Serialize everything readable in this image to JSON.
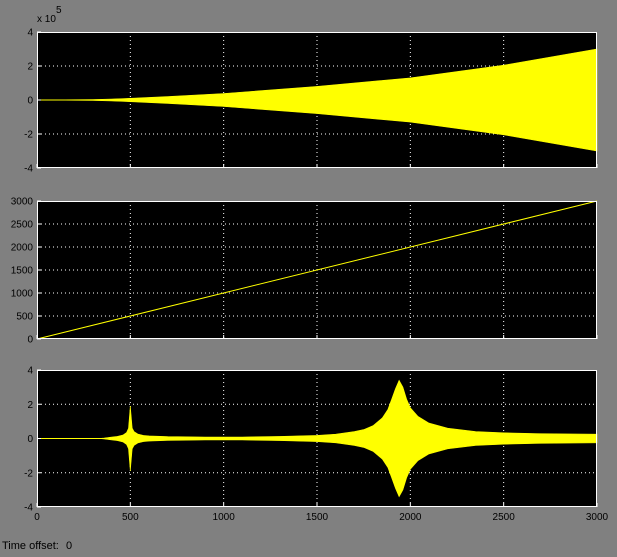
{
  "colors": {
    "figure_bg": "#808080",
    "axes_bg": "#000000",
    "trace": "#ffff00",
    "grid": "#ffffff",
    "text": "#000000"
  },
  "status": {
    "time_offset_label": "Time offset:",
    "time_offset_value": "0"
  },
  "chart_data": [
    {
      "type": "area",
      "description_style": "envelope",
      "xlim": [
        0,
        3000
      ],
      "ylim": [
        -4,
        4
      ],
      "y_multiplier_label": "x 10",
      "y_multiplier_exponent": "5",
      "xticks": [
        0,
        500,
        1000,
        1500,
        2000,
        2500,
        3000
      ],
      "yticks": [
        -4,
        -2,
        0,
        2,
        4
      ],
      "ytick_labels": [
        "-4",
        "-2",
        "0",
        "2",
        "4"
      ],
      "show_xtick_labels": false,
      "grid": true,
      "x": [
        0,
        300,
        400,
        500,
        700,
        1000,
        1500,
        2000,
        2500,
        3000
      ],
      "upper": [
        0.0,
        0.03,
        0.06,
        0.1,
        0.2,
        0.38,
        0.8,
        1.3,
        2.05,
        3.0
      ],
      "lower": [
        0.0,
        -0.03,
        -0.06,
        -0.1,
        -0.2,
        -0.38,
        -0.8,
        -1.3,
        -2.05,
        -3.0
      ]
    },
    {
      "type": "line",
      "xlim": [
        0,
        3000
      ],
      "ylim": [
        0,
        3000
      ],
      "xticks": [
        0,
        500,
        1000,
        1500,
        2000,
        2500,
        3000
      ],
      "yticks": [
        0,
        500,
        1000,
        1500,
        2000,
        2500,
        3000
      ],
      "ytick_labels": [
        "0",
        "500",
        "1000",
        "1500",
        "2000",
        "2500",
        "3000"
      ],
      "show_xtick_labels": false,
      "grid": true,
      "x": [
        0,
        3000
      ],
      "y": [
        0,
        3000
      ]
    },
    {
      "type": "area",
      "description_style": "envelope",
      "xlim": [
        0,
        3000
      ],
      "ylim": [
        -4,
        4
      ],
      "xticks": [
        0,
        500,
        1000,
        1500,
        2000,
        2500,
        3000
      ],
      "xtick_labels": [
        "0",
        "500",
        "1000",
        "1500",
        "2000",
        "2500",
        "3000"
      ],
      "yticks": [
        -4,
        -2,
        0,
        2,
        4
      ],
      "ytick_labels": [
        "-4",
        "-2",
        "0",
        "2",
        "4"
      ],
      "show_xtick_labels": true,
      "grid": true,
      "x": [
        0,
        330,
        360,
        400,
        430,
        460,
        480,
        490,
        500,
        510,
        520,
        540,
        570,
        600,
        700,
        900,
        1100,
        1300,
        1500,
        1600,
        1700,
        1750,
        1800,
        1850,
        1880,
        1900,
        1920,
        1940,
        1960,
        1980,
        2000,
        2040,
        2100,
        2200,
        2350,
        2500,
        2700,
        3000
      ],
      "upper": [
        0.0,
        0.0,
        0.03,
        0.08,
        0.12,
        0.2,
        0.35,
        0.6,
        1.9,
        0.6,
        0.4,
        0.26,
        0.18,
        0.15,
        0.11,
        0.09,
        0.09,
        0.12,
        0.18,
        0.25,
        0.4,
        0.52,
        0.75,
        1.2,
        1.7,
        2.3,
        2.9,
        3.4,
        3.0,
        2.3,
        1.8,
        1.3,
        0.9,
        0.6,
        0.4,
        0.33,
        0.28,
        0.25
      ],
      "lower": [
        0.0,
        0.0,
        -0.03,
        -0.08,
        -0.12,
        -0.2,
        -0.35,
        -0.6,
        -1.9,
        -0.6,
        -0.4,
        -0.26,
        -0.18,
        -0.15,
        -0.11,
        -0.09,
        -0.09,
        -0.12,
        -0.18,
        -0.25,
        -0.4,
        -0.52,
        -0.75,
        -1.2,
        -1.7,
        -2.3,
        -2.9,
        -3.4,
        -3.0,
        -2.3,
        -1.8,
        -1.3,
        -0.9,
        -0.6,
        -0.4,
        -0.33,
        -0.28,
        -0.25
      ]
    }
  ]
}
